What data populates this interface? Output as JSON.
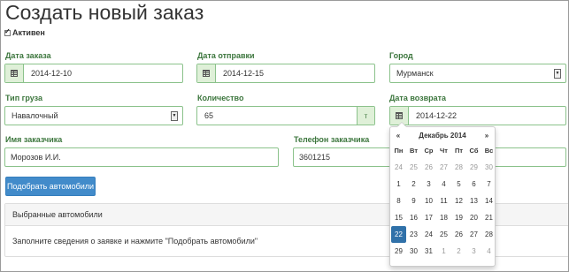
{
  "page": {
    "title": "Создать новый заказ"
  },
  "active": {
    "label": "Активен",
    "checked": true
  },
  "fields": {
    "order_date": {
      "label": "Дата заказа",
      "value": "2014-12-10",
      "icon": "calendar-icon"
    },
    "ship_date": {
      "label": "Дата отправки",
      "value": "2014-12-15",
      "icon": "calendar-icon"
    },
    "city": {
      "label": "Город",
      "value": "Мурманск"
    },
    "cargo_type": {
      "label": "Тип груза",
      "value": "Навалочный"
    },
    "quantity": {
      "label": "Количество",
      "value": "65",
      "unit": "т"
    },
    "return_date": {
      "label": "Дата возврата",
      "value": "2014-12-22",
      "icon": "calendar-icon"
    },
    "customer_name": {
      "label": "Имя заказчика",
      "value": "Морозов И.И."
    },
    "customer_phone": {
      "label": "Телефон заказчика",
      "value": "3601215"
    }
  },
  "find_button": {
    "label": "Подобрать автомобили"
  },
  "panel": {
    "heading": "Выбранные автомобили",
    "body": "Заполните сведения о заявке и нажмите \"Подобрать автомобили\""
  },
  "datepicker": {
    "prev": "«",
    "next": "»",
    "month": "Декабрь 2014",
    "weekdays": [
      "Пн",
      "Вт",
      "Ср",
      "Чт",
      "Пт",
      "Сб",
      "Вс"
    ],
    "days": [
      {
        "d": "24",
        "t": "old"
      },
      {
        "d": "25",
        "t": "old"
      },
      {
        "d": "26",
        "t": "old"
      },
      {
        "d": "27",
        "t": "old"
      },
      {
        "d": "28",
        "t": "old"
      },
      {
        "d": "29",
        "t": "old"
      },
      {
        "d": "30",
        "t": "old"
      },
      {
        "d": "1",
        "t": ""
      },
      {
        "d": "2",
        "t": ""
      },
      {
        "d": "3",
        "t": ""
      },
      {
        "d": "4",
        "t": ""
      },
      {
        "d": "5",
        "t": ""
      },
      {
        "d": "6",
        "t": ""
      },
      {
        "d": "7",
        "t": ""
      },
      {
        "d": "8",
        "t": ""
      },
      {
        "d": "9",
        "t": ""
      },
      {
        "d": "10",
        "t": ""
      },
      {
        "d": "11",
        "t": ""
      },
      {
        "d": "12",
        "t": ""
      },
      {
        "d": "13",
        "t": ""
      },
      {
        "d": "14",
        "t": ""
      },
      {
        "d": "15",
        "t": ""
      },
      {
        "d": "16",
        "t": ""
      },
      {
        "d": "17",
        "t": ""
      },
      {
        "d": "18",
        "t": ""
      },
      {
        "d": "19",
        "t": ""
      },
      {
        "d": "20",
        "t": ""
      },
      {
        "d": "21",
        "t": ""
      },
      {
        "d": "22",
        "t": "sel"
      },
      {
        "d": "23",
        "t": ""
      },
      {
        "d": "24",
        "t": ""
      },
      {
        "d": "25",
        "t": ""
      },
      {
        "d": "26",
        "t": ""
      },
      {
        "d": "27",
        "t": ""
      },
      {
        "d": "28",
        "t": ""
      },
      {
        "d": "29",
        "t": ""
      },
      {
        "d": "30",
        "t": ""
      },
      {
        "d": "31",
        "t": ""
      },
      {
        "d": "1",
        "t": "old"
      },
      {
        "d": "2",
        "t": "old"
      },
      {
        "d": "3",
        "t": "old"
      },
      {
        "d": "4",
        "t": "old"
      }
    ]
  },
  "colors": {
    "label_green": "#3c763d",
    "field_border": "#8bc28b",
    "addon_bg": "#dff0d8",
    "primary": "#428bca",
    "selected_day": "#3071a9"
  }
}
